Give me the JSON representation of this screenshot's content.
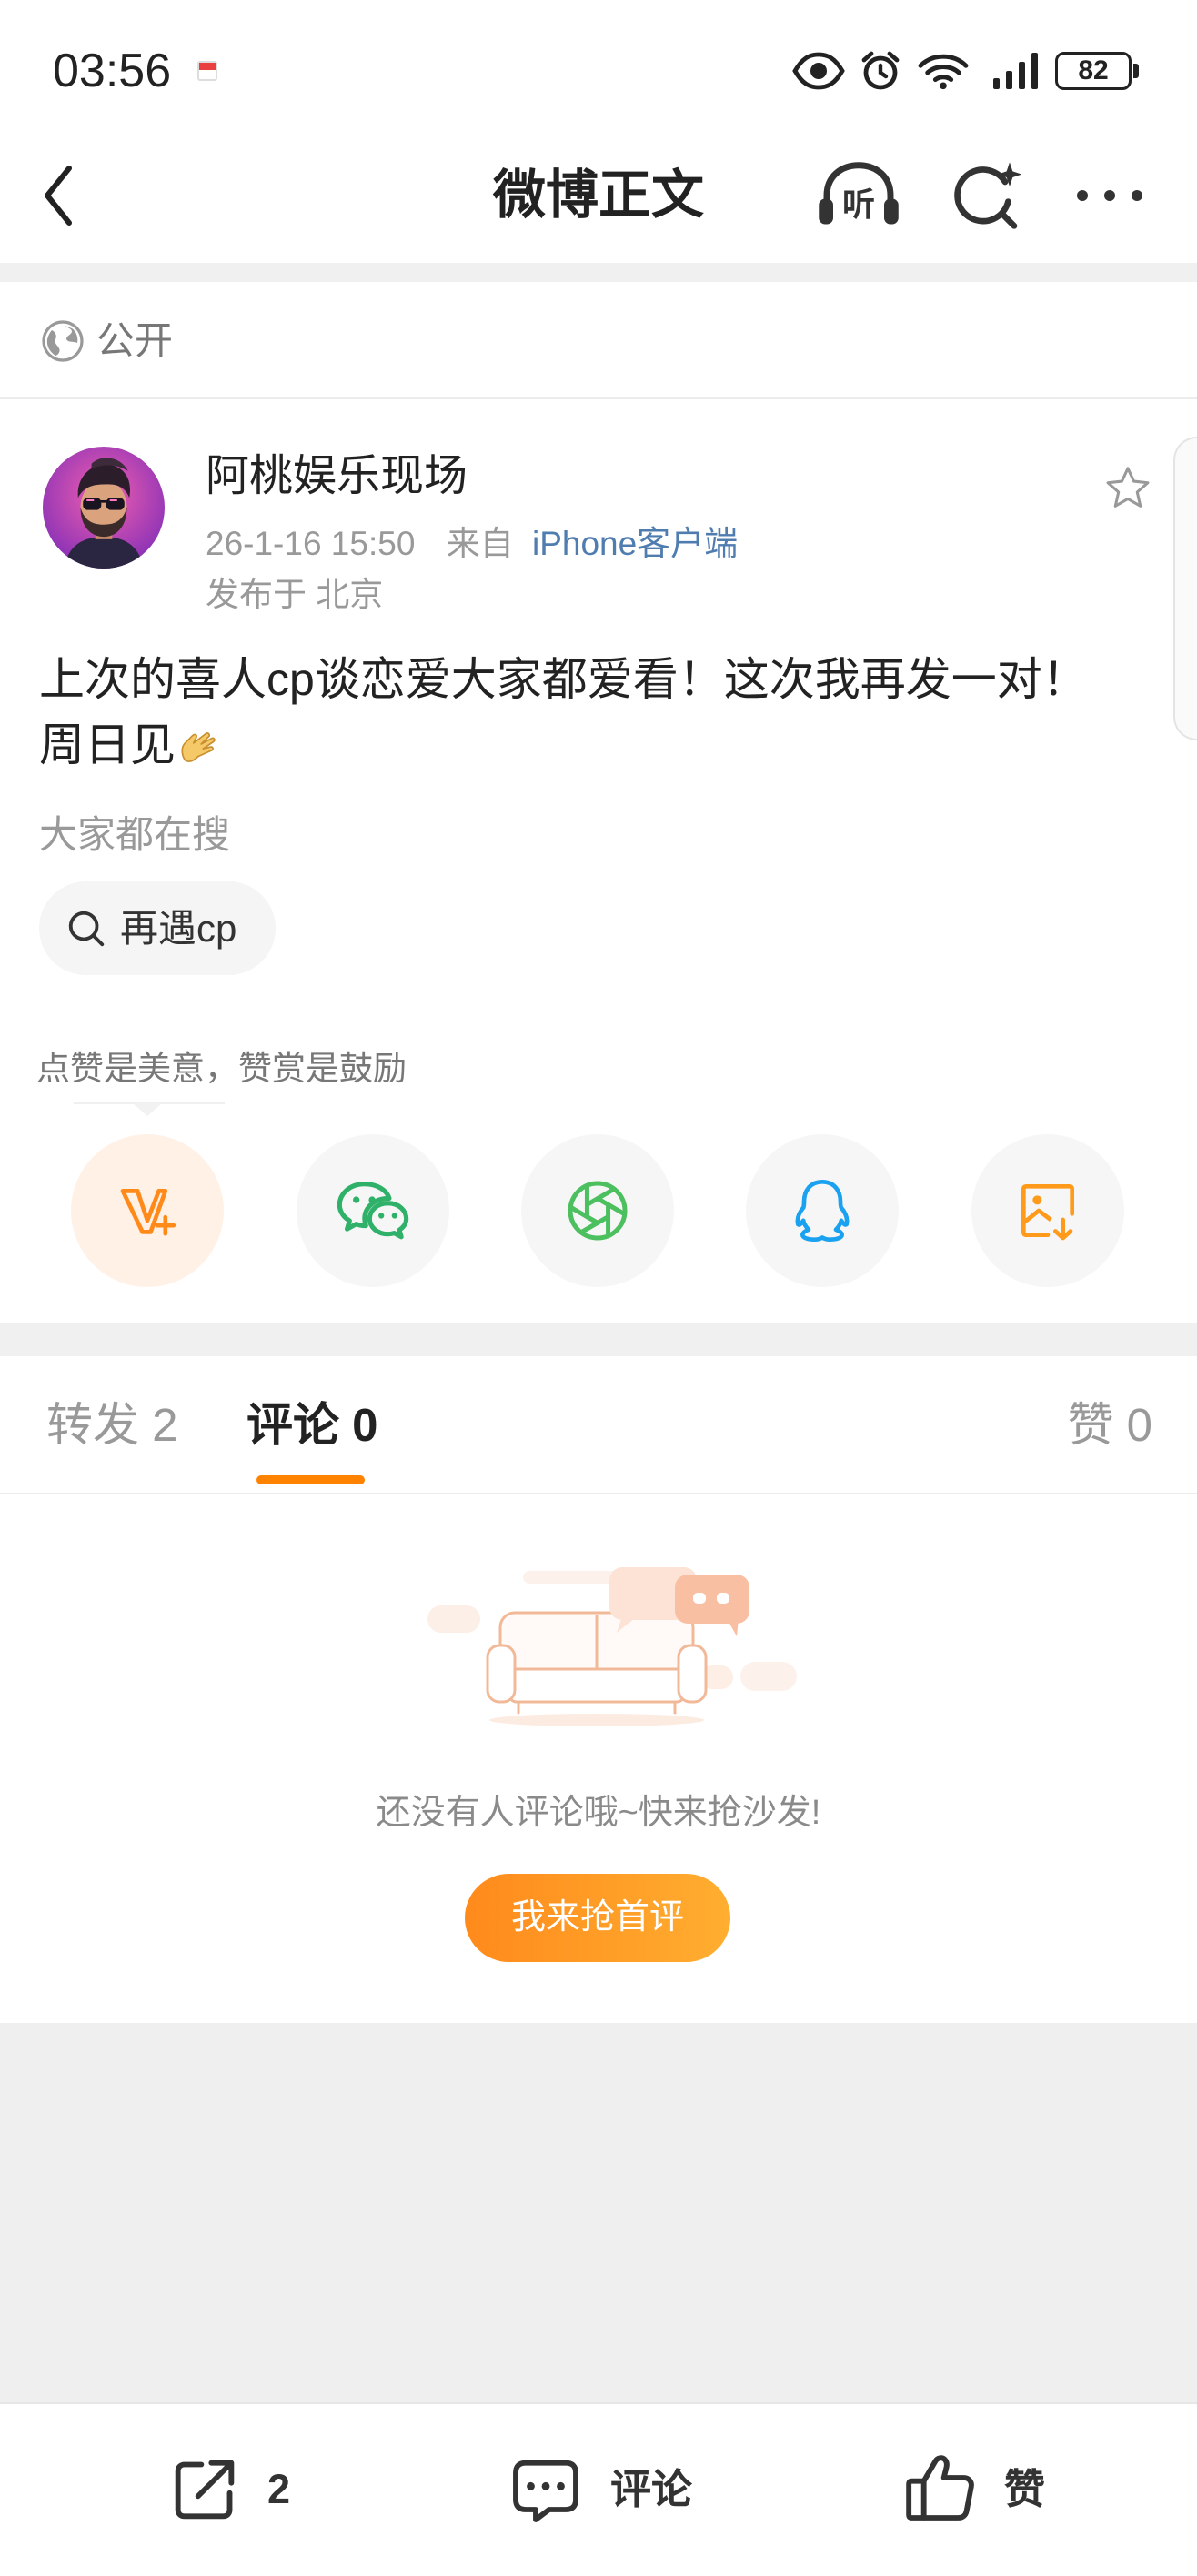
{
  "status_bar": {
    "time": "03:56",
    "battery": "82",
    "icons": [
      "notification-icon",
      "eye-icon",
      "alarm-icon",
      "wifi-icon",
      "signal-icon",
      "battery-icon"
    ]
  },
  "nav": {
    "title": "微博正文",
    "listen_label": "听",
    "icons": [
      "back-icon",
      "headphones-icon",
      "sparkle-search-icon",
      "more-icon"
    ]
  },
  "visibility": {
    "label": "公开",
    "icon": "globe-icon"
  },
  "post": {
    "author": "阿桃娱乐现场",
    "time": "26-1-16 15:50",
    "source_prefix": "来自",
    "source": "iPhone客户端",
    "location": "发布于 北京",
    "text_lines": [
      "上次的喜人cp谈恋爱大家都爱看！这次我再发一对！",
      "周日见"
    ],
    "emoji": "ok-hand-emoji"
  },
  "trending": {
    "label": "大家都在搜",
    "chip": "再遇cp"
  },
  "reward_tip": "点赞是美意，赞赏是鼓励",
  "share_options": [
    "v-plus-reward-icon",
    "wechat-icon",
    "moments-icon",
    "qq-icon",
    "save-image-icon"
  ],
  "tabs": [
    {
      "label": "转发 2",
      "active": false
    },
    {
      "label": "评论 0",
      "active": true
    },
    {
      "label": "赞 0",
      "active": false
    }
  ],
  "empty_state": {
    "message": "还没有人评论哦~快来抢沙发!",
    "button": "我来抢首评"
  },
  "bottom_bar": {
    "repost_count": "2",
    "comment_label": "评论",
    "like_label": "赞"
  },
  "colors": {
    "accent": "#ff8200",
    "link": "#507daf",
    "text": "#222222",
    "muted": "#999999"
  }
}
